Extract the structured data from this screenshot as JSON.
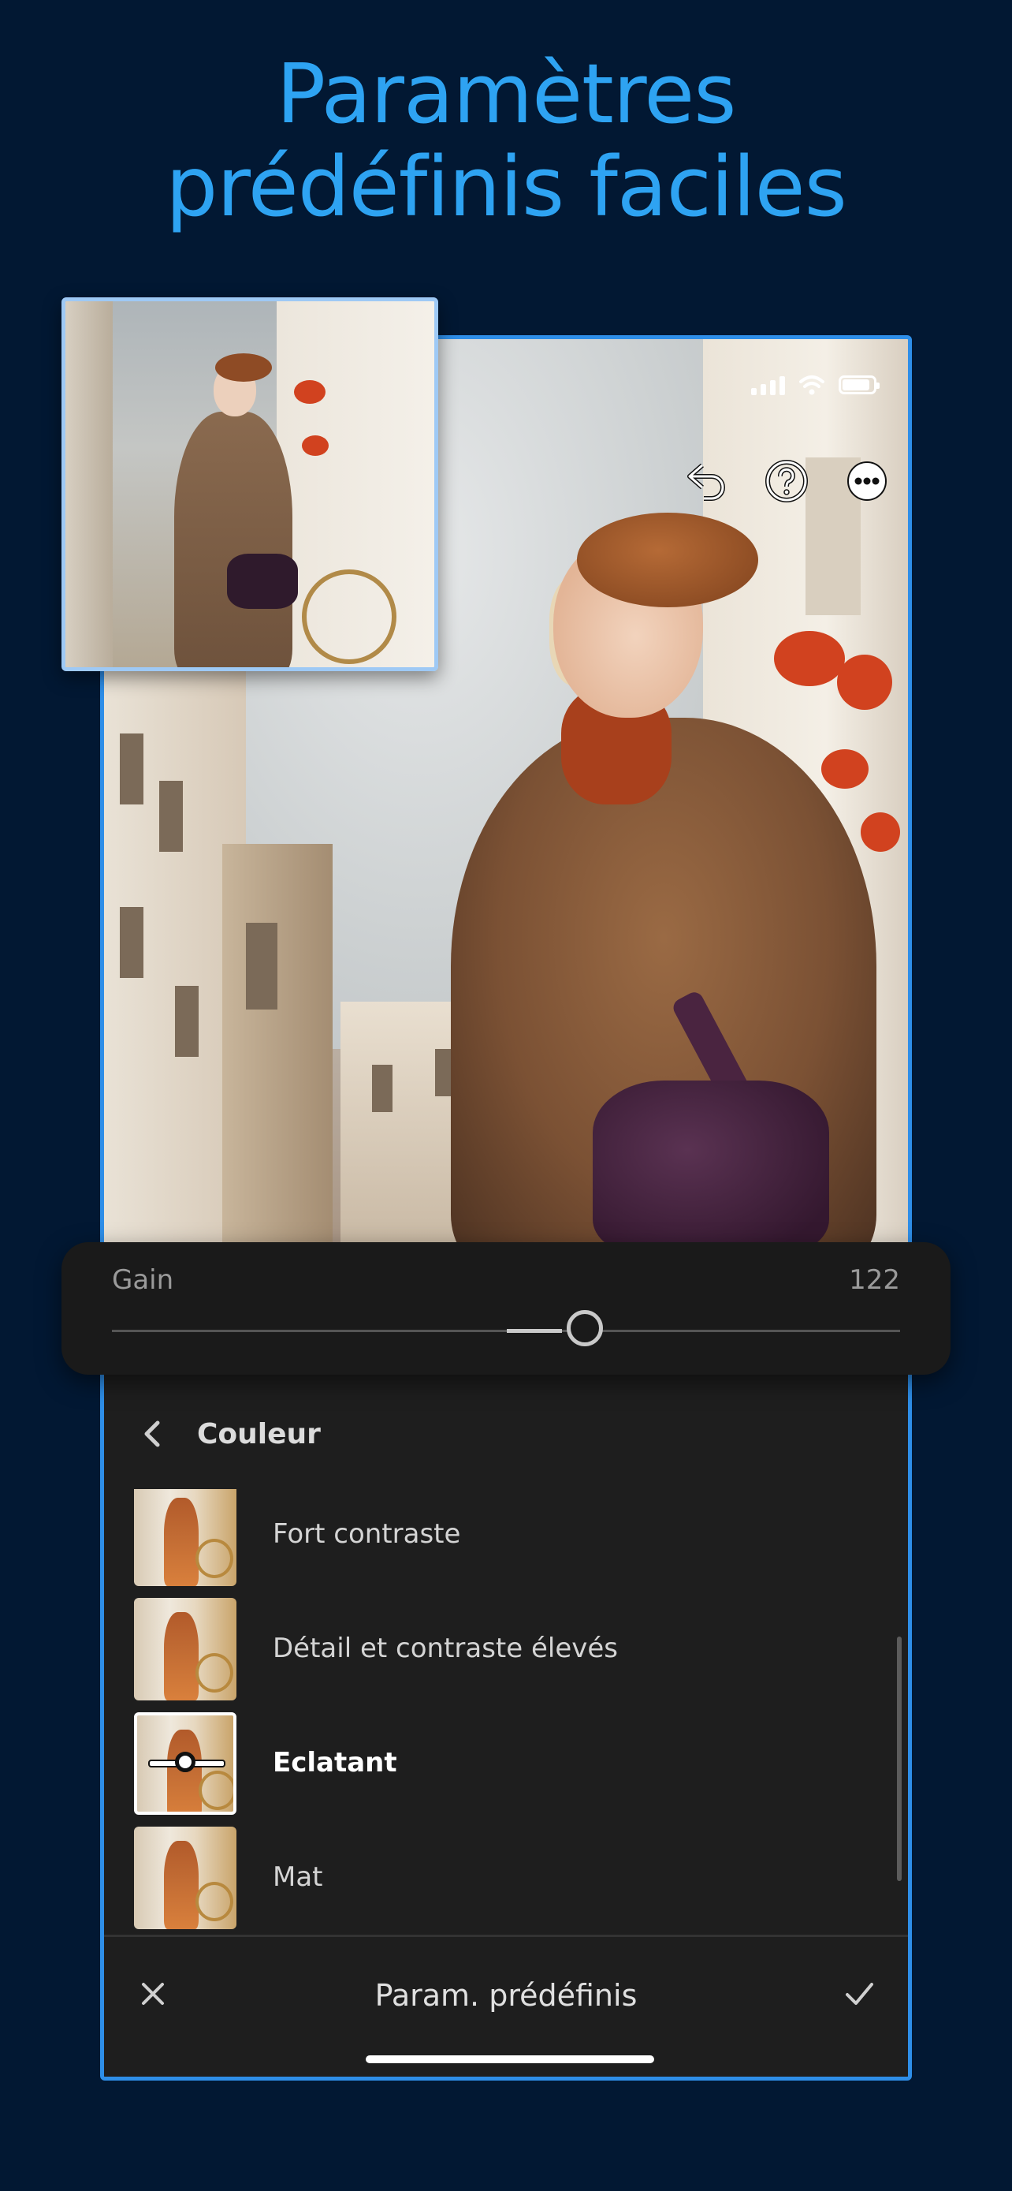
{
  "headline": {
    "line1": "Paramètres",
    "line2": "prédéfinis faciles"
  },
  "colors": {
    "background": "#021833",
    "headline": "#2ea3f2",
    "phone_border": "#2e8ee8",
    "panel": "#1e1e1e"
  },
  "toolbar": {
    "icons": [
      "undo-icon",
      "help-icon",
      "more-icon"
    ]
  },
  "status_bar": {
    "icons": [
      "signal-icon",
      "wifi-icon",
      "battery-icon"
    ]
  },
  "gain": {
    "label": "Gain",
    "value": "122",
    "slider_fraction": 0.6
  },
  "panel": {
    "back_icon": "chevron-left-icon",
    "title": "Couleur"
  },
  "presets": [
    {
      "label": "Fort contraste",
      "selected": false
    },
    {
      "label": "Détail et contraste élevés",
      "selected": false
    },
    {
      "label": "Eclatant",
      "selected": true
    },
    {
      "label": "Mat",
      "selected": false
    }
  ],
  "footer": {
    "cancel_icon": "close-icon",
    "title": "Param. prédéfinis",
    "confirm_icon": "checkmark-icon"
  }
}
